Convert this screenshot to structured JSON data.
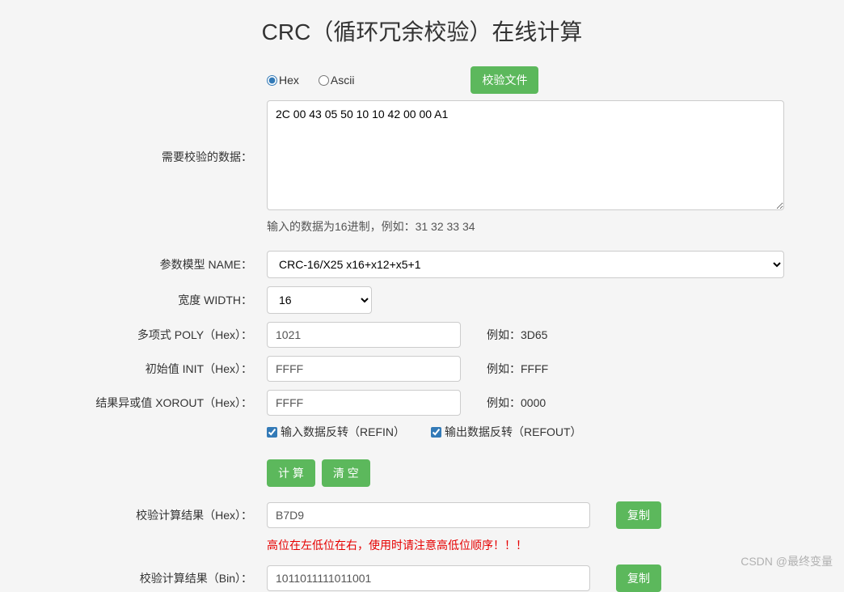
{
  "title": "CRC（循环冗余校验）在线计算",
  "input_mode": {
    "hex_label": "Hex",
    "ascii_label": "Ascii",
    "hex_checked": true,
    "ascii_checked": false
  },
  "verify_file_btn": "校验文件",
  "labels": {
    "data_to_check": "需要校验的数据：",
    "model_name": "参数模型 NAME：",
    "width": "宽度 WIDTH：",
    "poly": "多项式 POLY（Hex）：",
    "init": "初始值 INIT（Hex）：",
    "xorout": "结果异或值 XOROUT（Hex）：",
    "result_hex": "校验计算结果（Hex）：",
    "result_bin": "校验计算结果（Bin）："
  },
  "data_input": "2C 00 43 05 50 10 10 42 00 00 A1",
  "data_input_hint": "输入的数据为16进制，例如：31 32 33 34",
  "model": {
    "selected": "CRC-16/X25           x16+x12+x5+1"
  },
  "width_value": "16",
  "poly_value": "1021",
  "poly_example": "例如：3D65",
  "init_value": "FFFF",
  "init_example": "例如：FFFF",
  "xorout_value": "FFFF",
  "xorout_example": "例如：0000",
  "refin_label": "输入数据反转（REFIN）",
  "refout_label": "输出数据反转（REFOUT）",
  "calc_btn": "计 算",
  "clear_btn": "清 空",
  "copy_btn": "复制",
  "result_hex": "B7D9",
  "result_hex_hint": "高位在左低位在右，使用时请注意高低位顺序！！！",
  "result_bin": "1011011111011001",
  "watermark": "CSDN @最终变量"
}
